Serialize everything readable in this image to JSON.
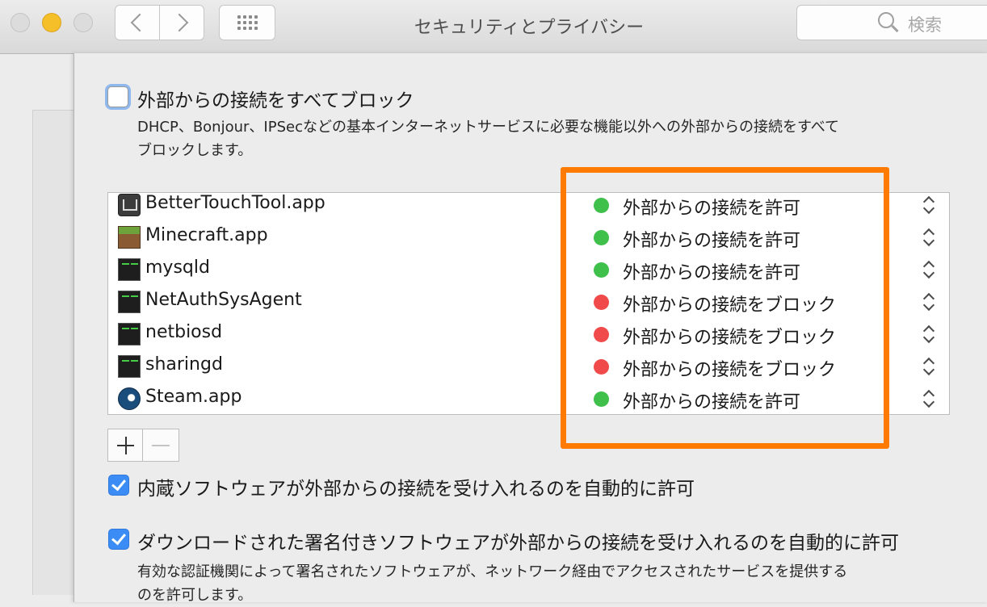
{
  "window": {
    "title": "セキュリティとプライバシー",
    "search_placeholder": "検索"
  },
  "firewall": {
    "block_all_label": "外部からの接続をすべてブロック",
    "block_all_checked": false,
    "block_all_desc_line1": "DHCP、Bonjour、IPSecなどの基本インターネットサービスに必要な機能以外への外部からの接続をすべて",
    "block_all_desc_line2": "ブロックします。",
    "apps": [
      {
        "name": "BetterTouchTool.app",
        "icon": "bettertouchtool-icon",
        "status": "外部からの接続を許可",
        "status_color": "#3fc04a"
      },
      {
        "name": "Minecraft.app",
        "icon": "minecraft-icon",
        "status": "外部からの接続を許可",
        "status_color": "#3fc04a"
      },
      {
        "name": "mysqld",
        "icon": "terminal-exec-icon",
        "status": "外部からの接続を許可",
        "status_color": "#3fc04a"
      },
      {
        "name": "NetAuthSysAgent",
        "icon": "terminal-exec-icon",
        "status": "外部からの接続をブロック",
        "status_color": "#f04a4a"
      },
      {
        "name": "netbiosd",
        "icon": "terminal-exec-icon",
        "status": "外部からの接続をブロック",
        "status_color": "#f04a4a"
      },
      {
        "name": "sharingd",
        "icon": "terminal-exec-icon",
        "status": "外部からの接続をブロック",
        "status_color": "#f04a4a"
      },
      {
        "name": "Steam.app",
        "icon": "steam-icon",
        "status": "外部からの接続を許可",
        "status_color": "#3fc04a"
      }
    ],
    "builtin_label": "内蔵ソフトウェアが外部からの接続を受け入れるのを自動的に許可",
    "builtin_checked": true,
    "signed_label": "ダウンロードされた署名付きソフトウェアが外部からの接続を受け入れるのを自動的に許可",
    "signed_checked": true,
    "signed_desc_line1": "有効な認証機関によって署名されたソフトウェアが、ネットワーク経由でアクセスされたサービスを提供する",
    "signed_desc_line2": "のを許可します。"
  },
  "colors": {
    "highlight": "#ff7a00",
    "allow": "#3fc04a",
    "block": "#f04a4a",
    "checkbox_blue": "#3b8cf5"
  }
}
